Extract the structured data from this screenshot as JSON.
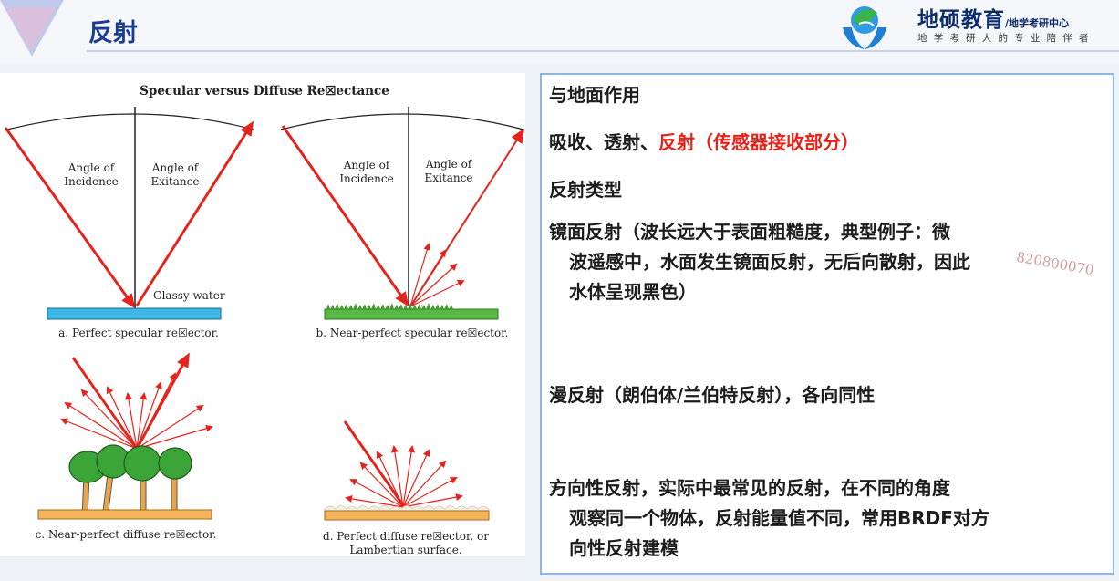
{
  "header": {
    "title": "反射",
    "brand_main": "地硕教育",
    "brand_sub": "/地学考研中心",
    "slogan": "地学考研人的专业陪伴者"
  },
  "figure": {
    "title": "Specular versus Diffuse Re☒ectance",
    "angle_incidence_a": "Angle of Incidence",
    "angle_exitance_a": "Angle of Exitance",
    "glassy_water": "Glassy water",
    "caption_a": "a. Perfect specular re☒ector.",
    "angle_incidence_b": "Angle of Incidence",
    "angle_exitance_b": "Angle of Exitance",
    "caption_b": "b. Near-perfect specular re☒ector.",
    "caption_c": "c. Near-perfect diffuse re☒ector.",
    "caption_d_line1": "d. Perfect diffuse re☒ector, or",
    "caption_d_line2": "Lambertian surface."
  },
  "panel": {
    "h1": "与地面作用",
    "l2_pre": "吸收、透射、",
    "l2_red": "反射（传感器接收部分）",
    "h2": "反射类型",
    "l4_line1": "镜面反射（波长远大于表面粗糙度，典型例子：微",
    "l4_line2": "波遥感中，水面发生镜面反射，无后向散射，因此",
    "l4_line3": "水体呈现黑色）",
    "l5": "漫反射（朗伯体/兰伯特反射），各向同性",
    "l6_line1": "方向性反射，实际中最常见的反射，在不同的角度",
    "l6_line2": "观察同一个物体，反射能量值不同，常用BRDF对方",
    "l6_line3": "向性反射建模",
    "watermark": "820800070",
    "bullet_glyph": "➢"
  },
  "colors": {
    "title": "#1a3d8f",
    "accent_red": "#e62117",
    "panel_border": "#8fb6e3",
    "water": "#3fb6e8",
    "grass": "#58b844",
    "ground": "#f6b45a"
  }
}
